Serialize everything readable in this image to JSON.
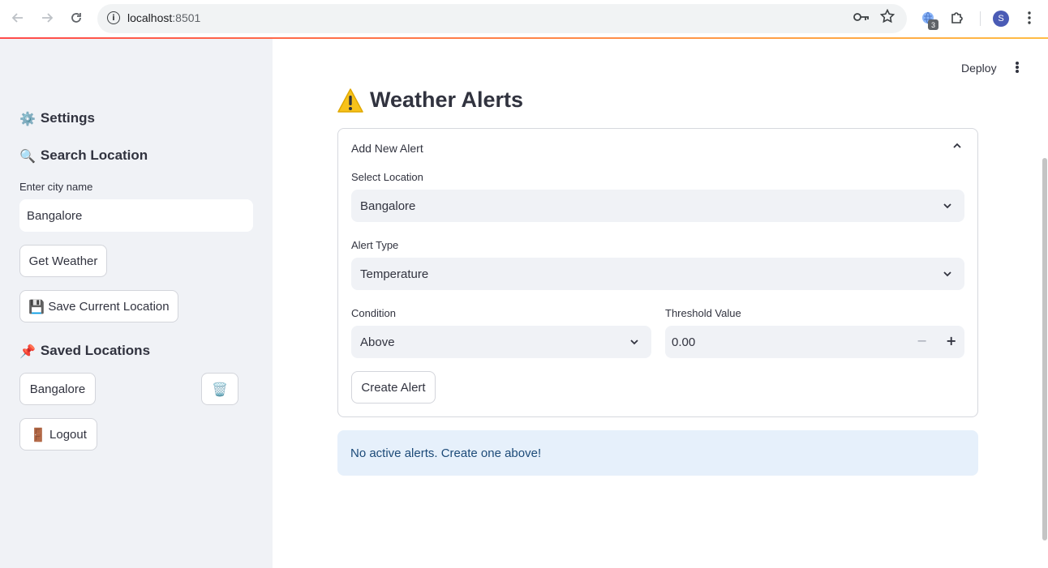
{
  "browser": {
    "url_host": "localhost",
    "url_port": ":8501",
    "extension_badge": "3",
    "profile_initial": "S"
  },
  "sidebar": {
    "settings_heading": "Settings",
    "search_heading": "Search Location",
    "city_label": "Enter city name",
    "city_value": "Bangalore",
    "get_weather_label": "Get Weather",
    "save_location_label": "Save Current Location",
    "saved_heading": "Saved Locations",
    "saved_items": [
      "Bangalore"
    ],
    "logout_label": "Logout"
  },
  "header": {
    "deploy_label": "Deploy"
  },
  "main": {
    "title": "Weather Alerts",
    "expander": {
      "title": "Add New Alert",
      "location_label": "Select Location",
      "location_value": "Bangalore",
      "alert_type_label": "Alert Type",
      "alert_type_value": "Temperature",
      "condition_label": "Condition",
      "condition_value": "Above",
      "threshold_label": "Threshold Value",
      "threshold_value": "0.00",
      "create_label": "Create Alert"
    },
    "info_message": "No active alerts. Create one above!"
  },
  "colors": {
    "accent_red": "#ff4b4b",
    "sidebar_bg": "#f0f2f6",
    "info_bg": "#e6f0fb",
    "info_text": "#1c4a78"
  }
}
